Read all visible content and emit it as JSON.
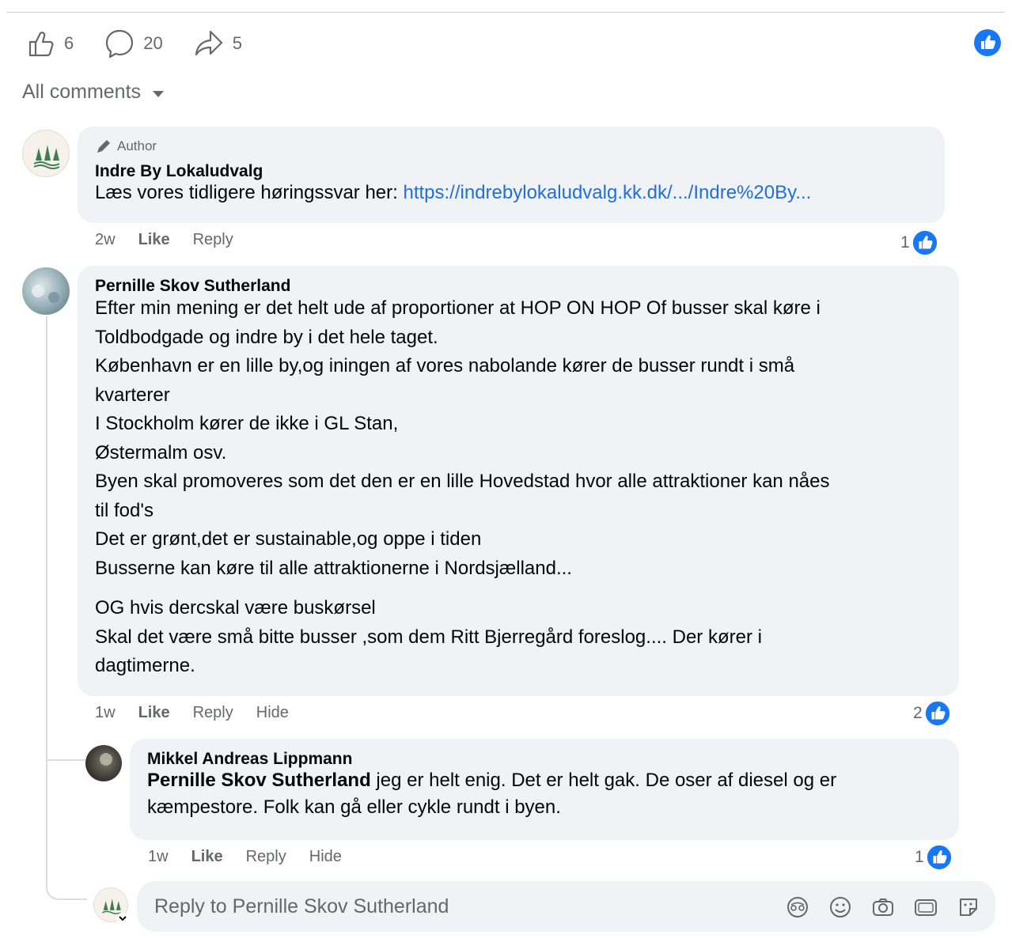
{
  "stats": {
    "likes": "6",
    "comments": "20",
    "shares": "5"
  },
  "comments_filter": "All comments",
  "comments": [
    {
      "badge": "Author",
      "author": "Indre By Lokaludvalg",
      "text_prefix": "Læs vores tidligere høringssvar her: ",
      "link": "https://indrebylokaludvalg.kk.dk/.../Indre%20By...",
      "time": "2w",
      "like": "Like",
      "reply": "Reply",
      "reactions": "1"
    },
    {
      "author": "Pernille Skov Sutherland",
      "lines": [
        "Efter min mening er det helt ude af proportioner at HOP ON HOP Of busser skal køre i",
        "Toldbodgade og indre by i det hele taget.",
        "København er en lille by,og iningen af vores nabolande kører de busser rundt i små",
        "kvarterer",
        "I Stockholm kører de ikke i GL Stan,",
        "Østermalm osv.",
        "Byen skal promoveres som det den er en lille Hovedstad hvor alle attraktioner kan nåes",
        "til fod's",
        "Det er grønt,det er sustainable,og oppe i tiden",
        "Busserne kan køre til alle attraktionerne i Nordsjælland..."
      ],
      "lines2": [
        "OG hvis dercskal være buskørsel",
        "Skal det være små bitte busser ,som dem Ritt Bjerregård foreslog.... Der kører i",
        "dagtimerne."
      ],
      "time": "1w",
      "like": "Like",
      "reply": "Reply",
      "hide": "Hide",
      "reactions": "2"
    },
    {
      "author": "Mikkel Andreas Lippmann",
      "mention": "Pernille Skov Sutherland",
      "text_line1": " jeg er helt enig. Det er helt gak. De oser af diesel og er",
      "text_line2": "kæmpestore. Folk kan gå eller cykle rundt i byen.",
      "time": "1w",
      "like": "Like",
      "reply": "Reply",
      "hide": "Hide",
      "reactions": "1"
    }
  ],
  "reply_box": {
    "placeholder": "Reply to Pernille Skov Sutherland"
  },
  "icons": [
    "like-icon",
    "comment-icon",
    "share-icon",
    "caret-down-icon",
    "pencil-icon",
    "avatar-check-down-icon",
    "avatar-icon",
    "sticker-emoji-icon",
    "emoji-icon",
    "camera-icon",
    "gif-icon",
    "sticker-icon"
  ],
  "colors": {
    "accent": "#1877f2",
    "link": "#216fdb",
    "bubble": "#f0f2f5",
    "muted": "#65676b"
  }
}
